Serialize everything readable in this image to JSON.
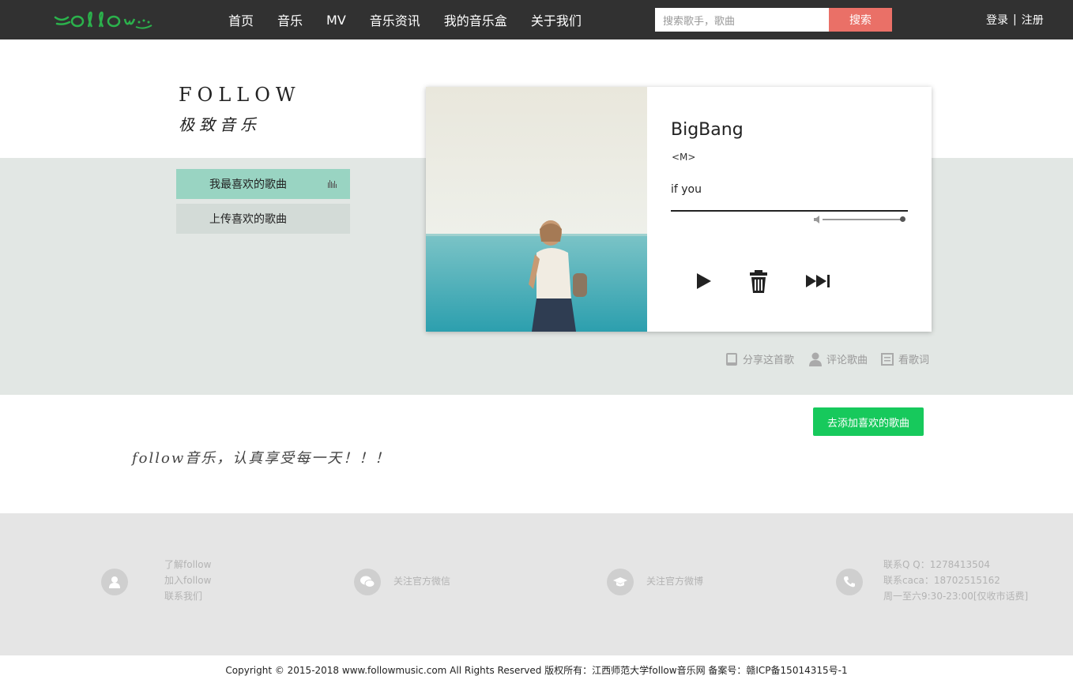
{
  "header": {
    "logo_text": "follow",
    "nav": [
      "首页",
      "音乐",
      "MV",
      "音乐资讯",
      "我的音乐盒",
      "关于我们"
    ],
    "search_placeholder": "搜索歌手，歌曲",
    "search_button": "搜索",
    "login": "登录",
    "separator": "|",
    "register": "注册"
  },
  "brand": {
    "title": "FOLLOW",
    "subtitle": "极致音乐"
  },
  "sidebar": {
    "items": [
      {
        "label": "我最喜欢的歌曲",
        "active": true
      },
      {
        "label": "上传喜欢的歌曲",
        "active": false
      }
    ]
  },
  "player": {
    "artist": "BigBang",
    "album": "<M>",
    "song": "if you",
    "progress": 1.0,
    "volume": 1.0
  },
  "actions": {
    "share": "分享这首歌",
    "comment": "评论歌曲",
    "lyrics": "看歌词"
  },
  "add_button": "去添加喜欢的歌曲",
  "slogan": "follow音乐，认真享受每一天！！！",
  "footer": {
    "about": [
      "了解follow",
      "加入follow",
      "联系我们"
    ],
    "wechat": "关注官方微信",
    "weibo": "关注官方微博",
    "contact": [
      "联系Q Q：1278413504",
      "联系caca：18702515162",
      "周一至六9:30-23:00[仅收市话费]"
    ]
  },
  "copyright": "Copyright © 2015-2018 www.followmusic.com All Rights Reserved 版权所有：江西师范大学follow音乐网 备案号：赣ICP备15014315号-1",
  "colors": {
    "header_bg": "#313131",
    "search_button": "#ea7067",
    "band_bg": "#e2e7e4",
    "active_menu": "#99d4c2",
    "add_button": "#17c95c",
    "logo": "#2bb24c"
  }
}
